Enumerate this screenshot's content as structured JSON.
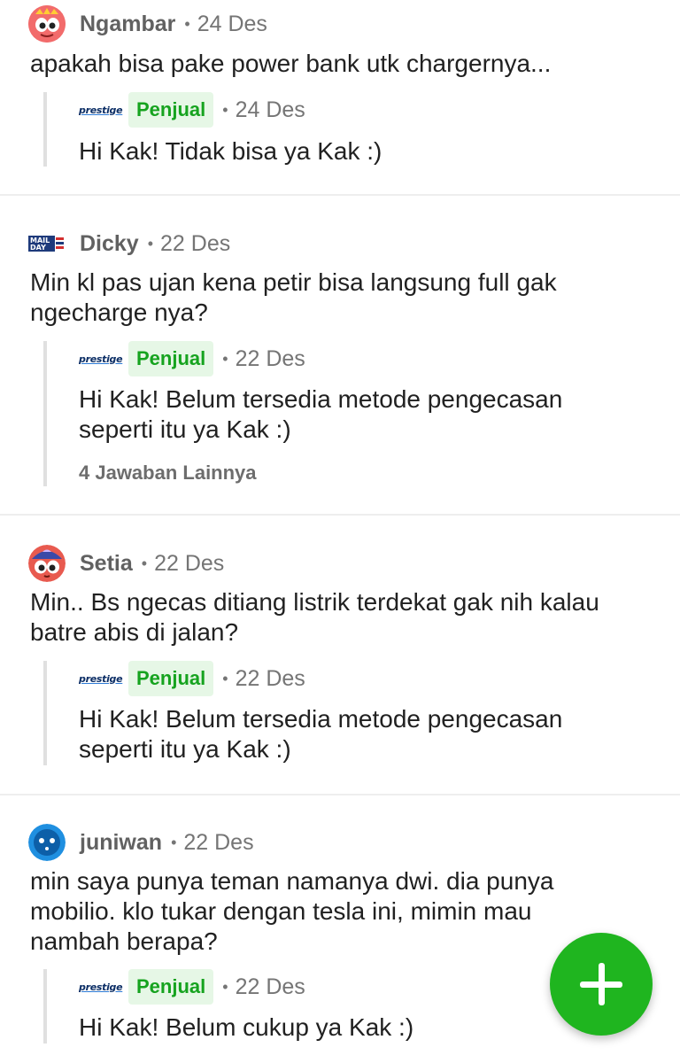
{
  "threads": [
    {
      "user": "Ngambar",
      "date": "24 Des",
      "avatar_icon": "pink-face-avatar-icon",
      "question": "apakah bisa pake power bank utk chargernya...",
      "reply": {
        "brand": "prestige",
        "badge": "Penjual",
        "date": "24 Des",
        "text": "Hi Kak! Tidak bisa ya Kak :)"
      }
    },
    {
      "user": "Dicky",
      "date": "22 Des",
      "avatar_icon": "mail-day-avatar-icon",
      "avatar_text": "MAIL DAY",
      "question": "Min kl pas ujan kena petir bisa langsung full gak\nngecharge nya?",
      "reply": {
        "brand": "prestige",
        "badge": "Penjual",
        "date": "22 Des",
        "text": "Hi Kak! Belum tersedia metode pengecasan\nseperti itu ya Kak :)"
      },
      "more_replies": "4 Jawaban Lainnya"
    },
    {
      "user": "Setia",
      "date": "22 Des",
      "avatar_icon": "red-face-avatar-icon",
      "question": "Min.. Bs ngecas ditiang listrik terdekat gak nih kalau\nbatre abis di jalan?",
      "reply": {
        "brand": "prestige",
        "badge": "Penjual",
        "date": "22 Des",
        "text": "Hi Kak! Belum tersedia metode pengecasan\nseperti itu ya Kak :)"
      }
    },
    {
      "user": "juniwan",
      "date": "22 Des",
      "avatar_icon": "blue-face-avatar-icon",
      "question": "min saya punya teman namanya dwi. dia punya\nmobilio. klo tukar dengan tesla ini, mimin mau\nnambah berapa?",
      "reply": {
        "brand": "prestige",
        "badge": "Penjual",
        "date": "22 Des",
        "text": "Hi Kak! Belum cukup ya Kak :)"
      }
    }
  ],
  "separator": "•",
  "fab": {
    "icon": "plus-icon",
    "color": "#1fb51f"
  },
  "colors": {
    "seller_badge_bg": "#e6f7e6",
    "seller_badge_text": "#16a31f"
  }
}
